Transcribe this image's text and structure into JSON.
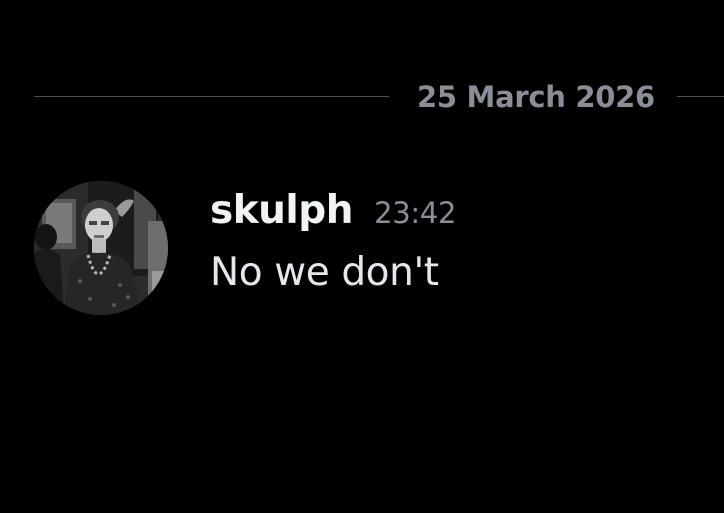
{
  "divider": {
    "date": "25 March 2026"
  },
  "message": {
    "username": "skulph",
    "timestamp": "23:42",
    "content": "No we don't",
    "avatar_icon": "user-avatar-photo"
  },
  "colors": {
    "background": "#000000",
    "divider_line": "#4f5158",
    "muted_text": "#8b8e97",
    "username": "#f2f3f5",
    "message_text": "#e6e7ea"
  }
}
